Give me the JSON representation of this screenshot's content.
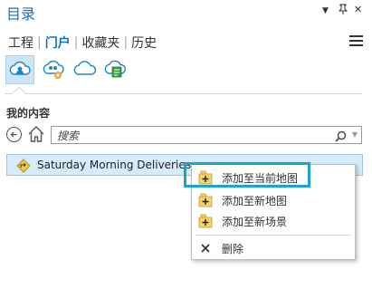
{
  "pane": {
    "title": "目录",
    "controls": {
      "dropdown": "▼",
      "pin": "ᛘ",
      "close": "✕"
    }
  },
  "tabs": [
    {
      "label": "工程",
      "active": false
    },
    {
      "label": "门户",
      "active": true
    },
    {
      "label": "收藏夹",
      "active": false
    },
    {
      "label": "历史",
      "active": false
    }
  ],
  "icon_row": [
    "my-content-icon",
    "groups-icon",
    "organization-icon",
    "living-atlas-icon"
  ],
  "section": {
    "label": "我的内容"
  },
  "search": {
    "placeholder": "搜索",
    "value": ""
  },
  "items": [
    {
      "label": "Saturday Morning Deliveries",
      "icon": "map-item-icon"
    }
  ],
  "context_menu": {
    "items": [
      {
        "label": "添加至当前地图",
        "icon": "add-icon",
        "highlighted": true
      },
      {
        "label": "添加至新地图",
        "icon": "add-icon"
      },
      {
        "label": "添加至新场景",
        "icon": "add-icon"
      },
      {
        "label": "删除",
        "icon": "delete-icon"
      }
    ]
  },
  "colors": {
    "accent": "#1b6fb3",
    "selection_bg": "#d7ecfa",
    "highlight_border": "#1aa3d9"
  }
}
